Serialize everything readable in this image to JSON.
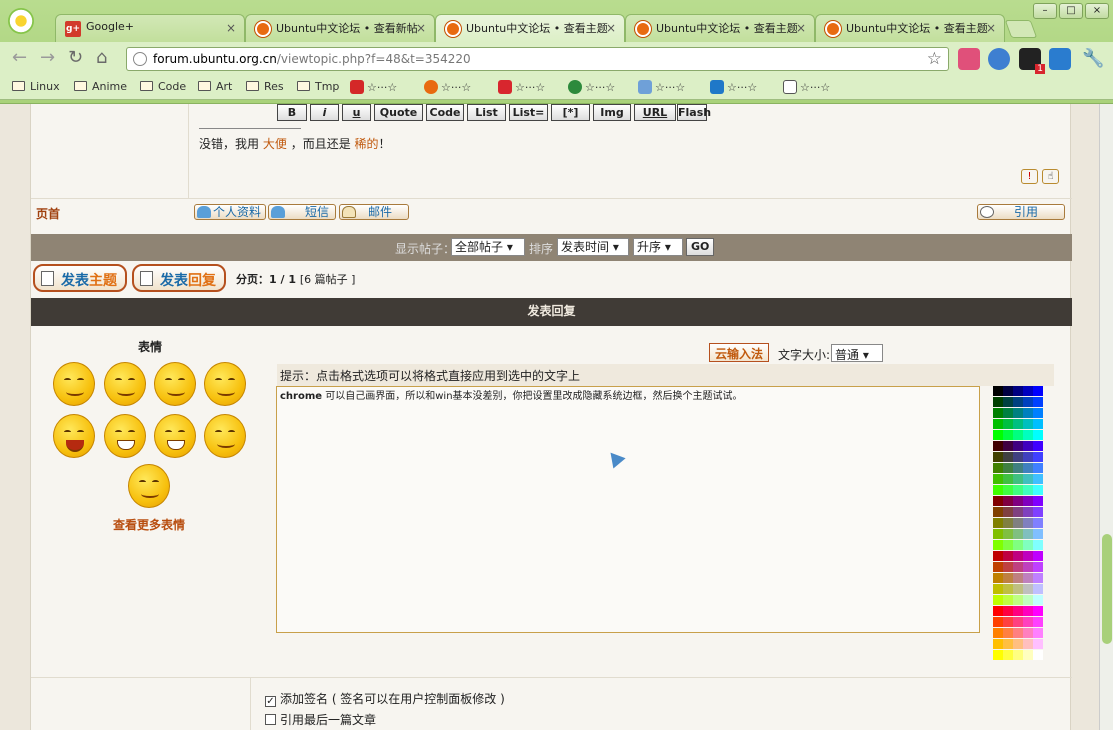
{
  "browser": {
    "tabs": [
      {
        "title": "Google+",
        "icon": "google-plus-icon",
        "active": false
      },
      {
        "title": "Ubuntu中文论坛 • 查看新帖",
        "icon": "ubuntu-icon",
        "active": false
      },
      {
        "title": "Ubuntu中文论坛 • 查看主题",
        "icon": "ubuntu-icon",
        "active": true
      },
      {
        "title": "Ubuntu中文论坛 • 查看主题",
        "icon": "ubuntu-icon",
        "active": false
      },
      {
        "title": "Ubuntu中文论坛 • 查看主题",
        "icon": "ubuntu-icon",
        "active": false
      }
    ],
    "url_host": "forum.ubuntu.org.cn",
    "url_path": "/viewtopic.php?f=48&t=354220",
    "bookmarks": [
      {
        "label": "Linux",
        "type": "folder"
      },
      {
        "label": "Anime",
        "type": "folder"
      },
      {
        "label": "Code",
        "type": "folder"
      },
      {
        "label": "Art",
        "type": "folder"
      },
      {
        "label": "Res",
        "type": "folder"
      },
      {
        "label": "Tmp",
        "type": "folder"
      },
      {
        "label": "☆···☆",
        "type": "youtube"
      },
      {
        "label": "☆···☆",
        "type": "ubuntu"
      },
      {
        "label": "☆···☆",
        "type": "vancl"
      },
      {
        "label": "☆···☆",
        "type": "site"
      },
      {
        "label": "☆···☆",
        "type": "site"
      },
      {
        "label": "☆···☆",
        "type": "pixiv"
      },
      {
        "label": "☆···☆",
        "type": "site"
      }
    ],
    "ext_badge": "1"
  },
  "post": {
    "signature_pre": "没错，我用",
    "signature_link1": "大便",
    "signature_mid": "，而且还是",
    "signature_link2": "稀的",
    "signature_post": "！",
    "report_icon": "!",
    "warn_icon": "☝"
  },
  "post_actions": {
    "top_link": "页首",
    "profile": "个人资料",
    "pm": "短信",
    "email": "邮件",
    "quote": "引用"
  },
  "filter": {
    "show_label": "显示帖子：",
    "show_value": "全部帖子",
    "sort_label": "排序",
    "sort_value": "发表时间",
    "order_value": "升序",
    "go": "GO"
  },
  "actions": {
    "new_topic_a": "发表",
    "new_topic_b": "主题",
    "reply_a": "发表",
    "reply_b": "回复",
    "pager": "分页：1 / 1",
    "post_count": "[6 篇帖子 ]"
  },
  "reply": {
    "header": "发表回复",
    "smilies_title": "表情",
    "more_smilies": "查看更多表情",
    "format_buttons": [
      "B",
      "i",
      "u",
      "Quote",
      "Code",
      "List",
      "List=",
      "[*]",
      "Img",
      "URL",
      "Flash"
    ],
    "cloud_ime": "云输入法",
    "font_size_label": "文字大小:",
    "font_size_value": "普通",
    "hint": "提示：点击格式选项可以将格式直接应用到选中的文字上",
    "editor_bold": "chrome",
    "editor_text": " 可以自己画界面，所以和win基本没差别，你把设置里改成隐藏系统边框，然后换个主题试试。",
    "add_signature": "添加签名 ( 签名可以在用户控制面板修改 )",
    "quote_last": "引用最后一篇文章"
  }
}
